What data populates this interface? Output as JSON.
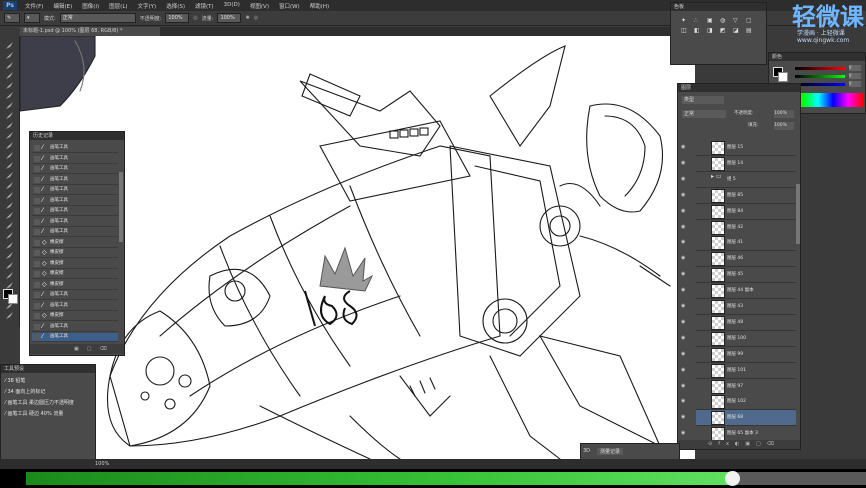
{
  "app": {
    "logo": "Ps"
  },
  "menu": [
    "文件(F)",
    "编辑(E)",
    "图像(I)",
    "图层(L)",
    "文字(Y)",
    "选择(S)",
    "滤镜(T)",
    "3D(D)",
    "视图(V)",
    "窗口(W)",
    "帮助(H)"
  ],
  "options": {
    "mode_label": "模式:",
    "mode_value": "正常",
    "opacity_label": "不透明度:",
    "opacity_value": "100%",
    "flow_label": "流量:",
    "flow_value": "100%"
  },
  "document": {
    "tab_title": "未标题-1.psd @ 100% (图层 68, RGB/8) *"
  },
  "status": {
    "zoom": "100%"
  },
  "video": {
    "progress": 0.84
  },
  "history": {
    "title": "历史记录",
    "rows": [
      {
        "label": "画笔工具",
        "icon": "brush-icon"
      },
      {
        "label": "画笔工具",
        "icon": "brush-icon"
      },
      {
        "label": "画笔工具",
        "icon": "brush-icon"
      },
      {
        "label": "画笔工具",
        "icon": "brush-icon"
      },
      {
        "label": "画笔工具",
        "icon": "brush-icon"
      },
      {
        "label": "画笔工具",
        "icon": "brush-icon"
      },
      {
        "label": "画笔工具",
        "icon": "brush-icon"
      },
      {
        "label": "画笔工具",
        "icon": "brush-icon"
      },
      {
        "label": "画笔工具",
        "icon": "brush-icon"
      },
      {
        "label": "橡皮擦",
        "icon": "eraser-icon"
      },
      {
        "label": "橡皮擦",
        "icon": "eraser-icon"
      },
      {
        "label": "橡皮擦",
        "icon": "eraser-icon"
      },
      {
        "label": "橡皮擦",
        "icon": "eraser-icon"
      },
      {
        "label": "橡皮擦",
        "icon": "eraser-icon"
      },
      {
        "label": "画笔工具",
        "icon": "brush-icon"
      },
      {
        "label": "画笔工具",
        "icon": "brush-icon"
      },
      {
        "label": "橡皮擦",
        "icon": "eraser-icon"
      },
      {
        "label": "画笔工具",
        "icon": "brush-icon"
      },
      {
        "label": "画笔工具",
        "icon": "brush-icon"
      }
    ]
  },
  "presets": {
    "title": "工具预设",
    "rows": [
      "38 铅笔",
      "34 面向上的标记",
      "画笔工具 柔边圆压力不透明度",
      "画笔工具 硬边 40% 流量"
    ]
  },
  "swatches": {
    "title": "色板"
  },
  "color": {
    "title": "颜色",
    "r": "0",
    "g": "0",
    "b": "0"
  },
  "layers": {
    "title": "图层",
    "kind_label": "类型",
    "blend": "正常",
    "opacity_label": "不透明度:",
    "opacity": "100%",
    "fill_label": "填充:",
    "fill": "100%",
    "rows": [
      {
        "name": "图层 15",
        "folder": false,
        "visible": true
      },
      {
        "name": "图层 14",
        "folder": false,
        "visible": true
      },
      {
        "name": "组 5",
        "folder": true,
        "visible": true
      },
      {
        "name": "图层 85",
        "folder": false,
        "visible": true
      },
      {
        "name": "图层 84",
        "folder": false,
        "visible": true
      },
      {
        "name": "图层 42",
        "folder": false,
        "visible": true
      },
      {
        "name": "图层 41",
        "folder": false,
        "visible": true
      },
      {
        "name": "图层 46",
        "folder": false,
        "visible": true
      },
      {
        "name": "图层 45",
        "folder": false,
        "visible": true
      },
      {
        "name": "图层 44 副本",
        "folder": false,
        "visible": true
      },
      {
        "name": "图层 43",
        "folder": false,
        "visible": true
      },
      {
        "name": "图层 48",
        "folder": false,
        "visible": true
      },
      {
        "name": "图层 100",
        "folder": false,
        "visible": true
      },
      {
        "name": "图层 99",
        "folder": false,
        "visible": true
      },
      {
        "name": "图层 101",
        "folder": false,
        "visible": true
      },
      {
        "name": "图层 97",
        "folder": false,
        "visible": true
      },
      {
        "name": "图层 102",
        "folder": false,
        "visible": true
      },
      {
        "name": "图层 68",
        "folder": false,
        "visible": true
      },
      {
        "name": "图层 65 副本 3",
        "folder": false,
        "visible": true
      }
    ]
  },
  "mini": {
    "label": "3D",
    "value": "测量记录"
  },
  "watermark": {
    "logo": "轻微课",
    "sub": "学漫画 · 上轻微课",
    "url": "www.qingwk.com"
  },
  "colors": {
    "accent": "#3d5f8c",
    "progress": "#36c236"
  }
}
